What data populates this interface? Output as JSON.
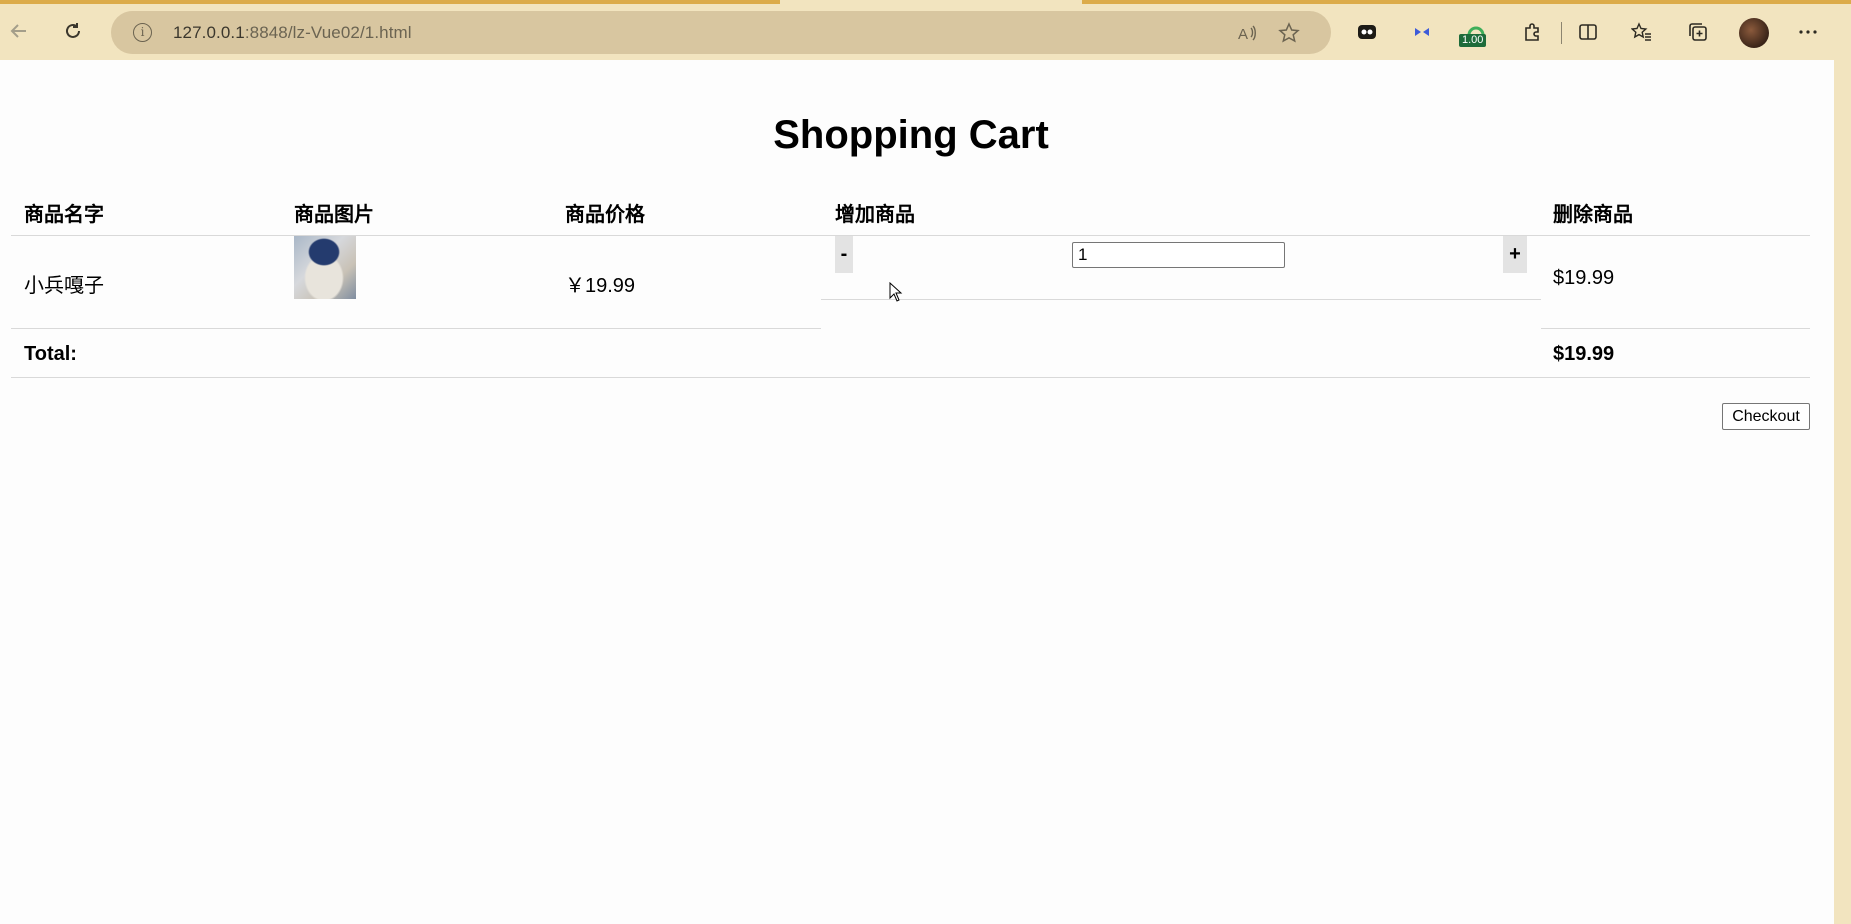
{
  "browser": {
    "url_host": "127.0.0.1",
    "url_rest": ":8848/lz-Vue02/1.html",
    "extension_badge": "1.00"
  },
  "page": {
    "title": "Shopping Cart",
    "headers": {
      "name": "商品名字",
      "image": "商品图片",
      "price": "商品价格",
      "add": "增加商品",
      "remove": "删除商品"
    },
    "items": [
      {
        "name": "小兵嘎子",
        "price": "￥19.99",
        "decrement_label": "-",
        "quantity": "1",
        "increment_label": "+",
        "subtotal": "$19.99"
      }
    ],
    "total_label": "Total:",
    "total_value": "$19.99",
    "checkout_label": "Checkout"
  }
}
